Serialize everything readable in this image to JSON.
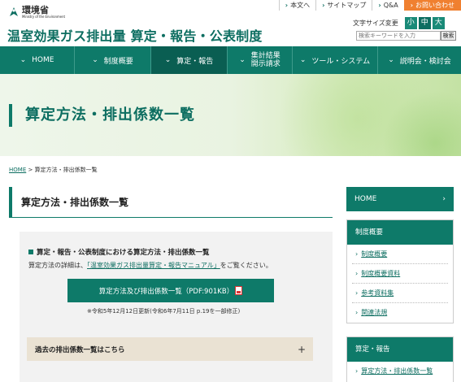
{
  "header": {
    "logo_jp": "環境省",
    "logo_en": "Ministry of the Environment",
    "site_title": "温室効果ガス排出量 算定・報告・公表制度"
  },
  "utility": {
    "items": [
      "本文へ",
      "サイトマップ",
      "Q&A"
    ],
    "contact": "お問い合わせ"
  },
  "font_size": {
    "label": "文字サイズ変更",
    "options": [
      "小",
      "中",
      "大"
    ]
  },
  "search": {
    "placeholder": "検索キーワードを入力",
    "button": "検索"
  },
  "gnav": {
    "items": [
      {
        "label": "HOME"
      },
      {
        "label": "制度概要"
      },
      {
        "label": "算定・報告"
      },
      {
        "label1": "集計結果",
        "label2": "開示請求"
      },
      {
        "label": "ツール・システム"
      },
      {
        "label": "説明会・検討会"
      }
    ]
  },
  "hero": {
    "title": "算定方法・排出係数一覧"
  },
  "breadcrumb": {
    "home": "HOME",
    "separator": " > ",
    "current": "算定方法・排出係数一覧"
  },
  "main": {
    "heading": "算定方法・排出係数一覧",
    "panel_heading": "算定・報告・公表制度における算定方法・排出係数一覧",
    "desc_before": "算定方法の詳細は、",
    "desc_link": "「温室効果ガス排出量算定・報告マニュアル」",
    "desc_after": "をご覧ください。",
    "pdf_button": "算定方法及び排出係数一覧（PDF:901KB）",
    "note": "※令和5年12月12日更新(令和6年7月11日 p.19を一部修正)",
    "accordion": "過去の排出係数一覧はこちら",
    "accordion_icon": "+"
  },
  "side": {
    "home": "HOME",
    "sections": [
      {
        "heading": "制度概要",
        "items": [
          "制度概要",
          "制度概要資料",
          "参考資料集",
          "関連法規"
        ]
      },
      {
        "heading": "算定・報告",
        "items": [
          "算定方法・排出係数一覧"
        ]
      }
    ]
  },
  "colors": {
    "brand": "#0e7a69",
    "contact": "#f08030",
    "accordion": "#eae2d3"
  }
}
